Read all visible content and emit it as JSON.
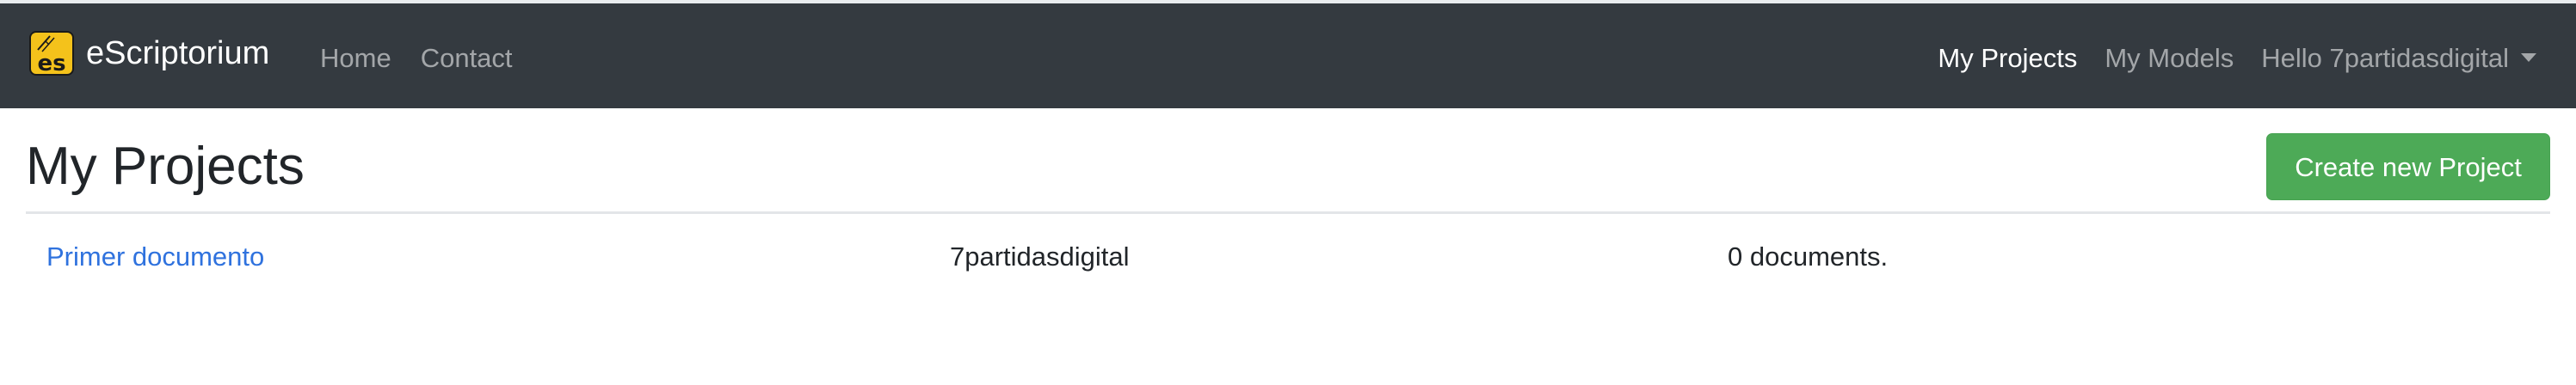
{
  "navbar": {
    "brand": "eScriptorium",
    "logo_text": "es",
    "left_links": [
      "Home",
      "Contact"
    ],
    "right_links": [
      "My Projects",
      "My Models"
    ],
    "user_menu_label": "Hello 7partidasdigital"
  },
  "colors": {
    "navbar_bg": "#343a40",
    "logo_bg": "#f4c21b",
    "primary_button": "#4daa57",
    "link": "#2f72de"
  },
  "icons": {
    "brand_logo": "escriptorium-logo-icon",
    "user_menu": "caret-down-icon"
  },
  "main": {
    "title": "My Projects",
    "create_button_label": "Create new Project",
    "projects": [
      {
        "name": "Primer documento",
        "owner": "7partidasdigital",
        "documents": "0 documents."
      }
    ]
  }
}
